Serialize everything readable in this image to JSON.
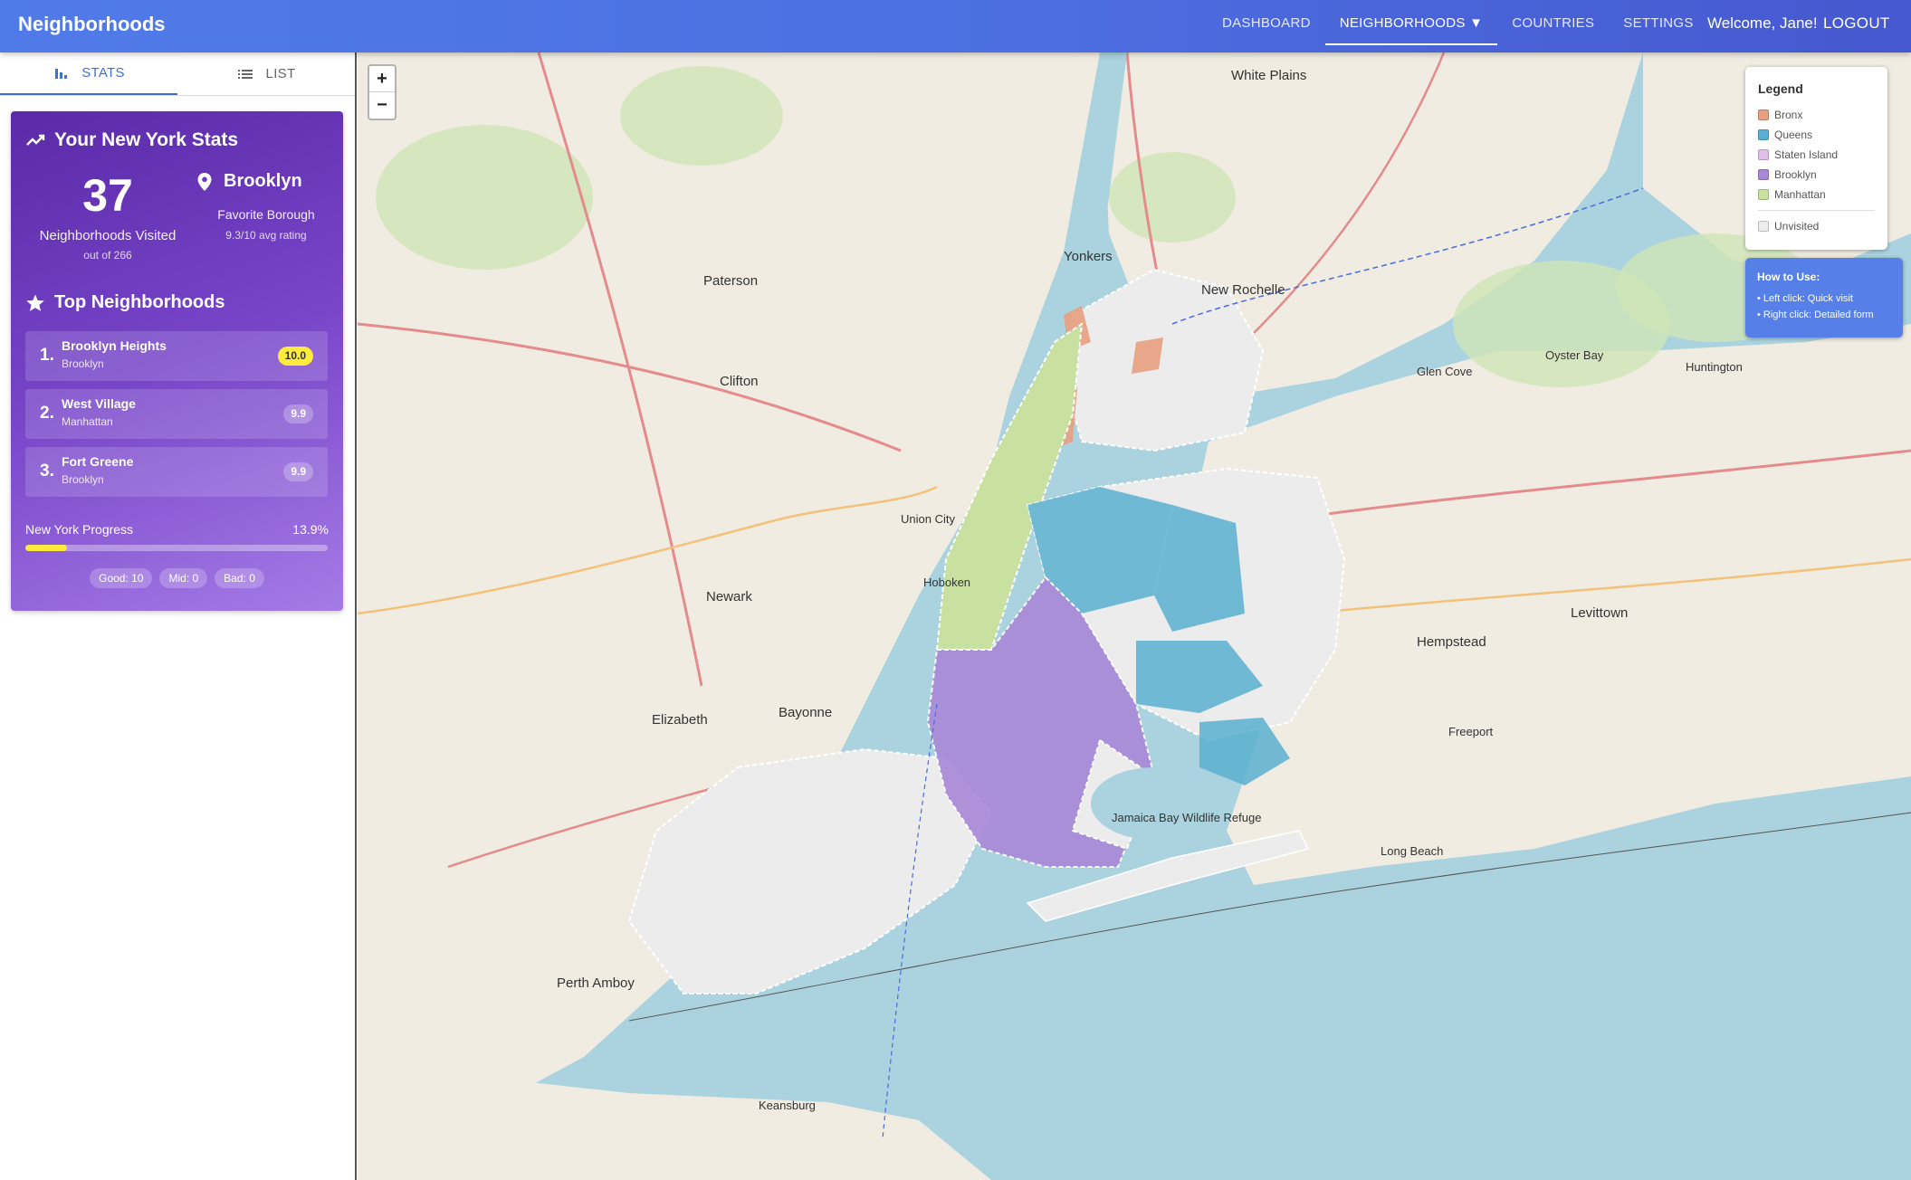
{
  "app": {
    "brand": "Neighborhoods"
  },
  "nav": {
    "items": [
      "DASHBOARD",
      "NEIGHBORHOODS ▼",
      "COUNTRIES",
      "SETTINGS"
    ],
    "welcome": "Welcome, Jane!",
    "logout": "LOGOUT"
  },
  "sidebar": {
    "tabs": [
      {
        "label": "STATS",
        "icon": "bar-chart-icon"
      },
      {
        "label": "LIST",
        "icon": "list-icon"
      }
    ],
    "stats": {
      "title": "Your New York Stats",
      "visited_count": "37",
      "visited_label": "Neighborhoods Visited",
      "out_of": "out of 266",
      "favorite_borough": "Brooklyn",
      "favorite_label": "Favorite Borough",
      "favorite_rating": "9.3/10 avg rating",
      "top_title": "Top Neighborhoods",
      "top": [
        {
          "rank": "1.",
          "name": "Brooklyn Heights",
          "borough": "Brooklyn",
          "score": "10.0"
        },
        {
          "rank": "2.",
          "name": "West Village",
          "borough": "Manhattan",
          "score": "9.9"
        },
        {
          "rank": "3.",
          "name": "Fort Greene",
          "borough": "Brooklyn",
          "score": "9.9"
        }
      ],
      "progress_label": "New York Progress",
      "progress_pct": "13.9%",
      "progress_value": 0.139,
      "chips": [
        "Good: 10",
        "Mid: 0",
        "Bad: 0"
      ]
    }
  },
  "map": {
    "zoom_in": "+",
    "zoom_out": "−",
    "legend": {
      "title": "Legend",
      "items": [
        {
          "label": "Bronx",
          "color": "#e8a080"
        },
        {
          "label": "Queens",
          "color": "#5ab0d0"
        },
        {
          "label": "Staten Island",
          "color": "#e0c0e8"
        },
        {
          "label": "Brooklyn",
          "color": "#a888d8"
        },
        {
          "label": "Manhattan",
          "color": "#c8e0a0"
        }
      ],
      "unvisited": {
        "label": "Unvisited",
        "color": "#ececec"
      }
    },
    "howto": {
      "title": "How to Use:",
      "lines": [
        "• Left click: Quick visit",
        "• Right click: Detailed form"
      ]
    },
    "labels": [
      "White Plains",
      "Yonkers",
      "New Rochelle",
      "Paterson",
      "Clifton",
      "Newark",
      "Elizabeth",
      "Bayonne",
      "Hoboken",
      "Union City",
      "Hempstead",
      "Levittown",
      "Glen Cove",
      "Huntington",
      "Long Beach",
      "Perth Amboy",
      "Keansburg",
      "Freeport",
      "Oyster Bay",
      "Jamaica Bay Wildlife Refuge"
    ]
  }
}
